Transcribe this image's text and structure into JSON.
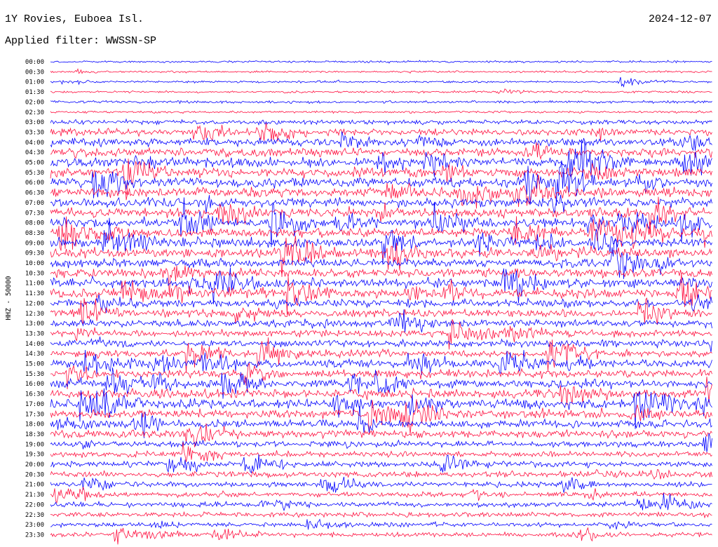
{
  "header": {
    "station": "1Y Rovies, Euboea Isl.",
    "date": "2024-12-07",
    "filter": "Applied filter: WWSSN-SP"
  },
  "chart_data": {
    "type": "line",
    "title": "1Y Rovies, Euboea Isl.",
    "subtitle": "Applied filter: WWSSN-SP",
    "ylabel": "HHZ - 50000",
    "xlabel": "",
    "grid": false,
    "legend": "none",
    "minutes_per_trace": 30,
    "colors": {
      "odd": "#0000ff",
      "even": "#ff0f3f",
      "text": "#000000"
    },
    "categories": [
      "00:00",
      "00:30",
      "01:00",
      "01:30",
      "02:00",
      "02:30",
      "03:00",
      "03:30",
      "04:00",
      "04:30",
      "05:00",
      "05:30",
      "06:00",
      "06:30",
      "07:00",
      "07:30",
      "08:00",
      "08:30",
      "09:00",
      "09:30",
      "10:00",
      "10:30",
      "11:00",
      "11:30",
      "12:00",
      "12:30",
      "13:00",
      "13:30",
      "14:00",
      "14:30",
      "15:00",
      "15:30",
      "16:00",
      "16:30",
      "17:00",
      "17:30",
      "18:00",
      "18:30",
      "19:00",
      "19:30",
      "20:00",
      "20:30",
      "21:00",
      "21:30",
      "22:00",
      "22:30",
      "23:00",
      "23:30"
    ],
    "amplitude_level": [
      0.12,
      0.1,
      0.1,
      0.1,
      0.18,
      0.12,
      0.4,
      0.7,
      0.9,
      0.95,
      1.0,
      1.0,
      1.0,
      1.0,
      1.0,
      1.0,
      1.0,
      1.0,
      1.0,
      1.0,
      1.0,
      1.0,
      1.0,
      1.0,
      0.85,
      0.8,
      0.75,
      0.7,
      0.75,
      0.75,
      0.8,
      0.85,
      0.9,
      0.95,
      1.0,
      0.95,
      0.85,
      0.75,
      0.6,
      0.55,
      0.55,
      0.55,
      0.45,
      0.45,
      0.45,
      0.45,
      0.4,
      0.4
    ]
  }
}
